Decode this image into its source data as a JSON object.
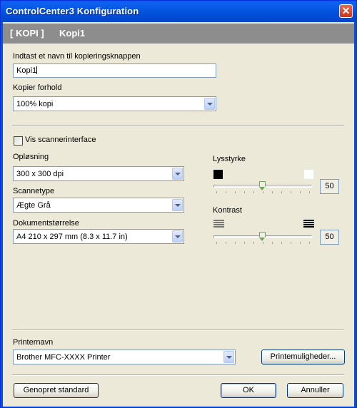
{
  "window": {
    "title": "ControlCenter3 Konfiguration",
    "close_glyph": "✕"
  },
  "header": {
    "section": "[ KOPI ]",
    "name": "Kopi1"
  },
  "name_field": {
    "label": "Indtast et navn til kopieringsknappen",
    "value": "Kopi1"
  },
  "copy_ratio": {
    "label": "Kopier forhold",
    "value": "100% kopi"
  },
  "scanner_interface": {
    "label": "Vis scannerinterface",
    "checked": false
  },
  "resolution": {
    "label": "Opløsning",
    "value": "300 x 300 dpi"
  },
  "scan_type": {
    "label": "Scannetype",
    "value": "Ægte Grå"
  },
  "document_size": {
    "label": "Dokumentstørrelse",
    "value": "A4 210 x 297 mm (8.3 x 11.7 in)"
  },
  "brightness": {
    "label": "Lysstyrke",
    "value": "50",
    "level": 0.5
  },
  "contrast": {
    "label": "Kontrast",
    "value": "50",
    "level": 0.5
  },
  "printer": {
    "label": "Printernavn",
    "value": "Brother MFC-XXXX Printer",
    "options_button": "Printemuligheder..."
  },
  "buttons": {
    "restore": "Genopret standard",
    "ok": "OK",
    "cancel": "Annuller"
  },
  "colors": {
    "titlebar": "#0148d0",
    "header_band": "#8d8d8d",
    "dialog_bg": "#ece9d8",
    "slider_thumb": "#6fa65b"
  }
}
